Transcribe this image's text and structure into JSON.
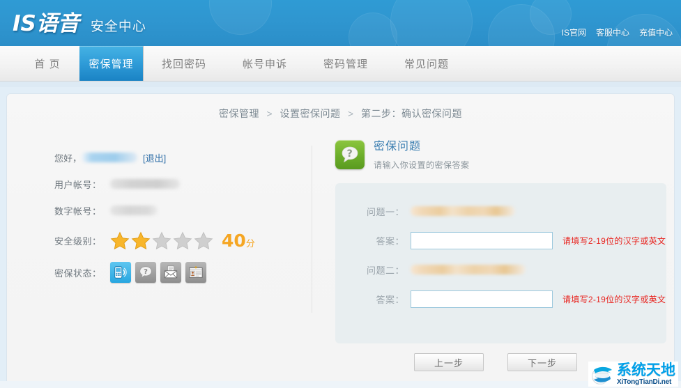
{
  "header": {
    "logo_main": "IS语音",
    "logo_sub": "安全中心",
    "links": [
      {
        "label": "IS官网",
        "name": "link-official-site"
      },
      {
        "label": "客服中心",
        "name": "link-service-center"
      },
      {
        "label": "充值中心",
        "name": "link-recharge-center"
      }
    ]
  },
  "nav": {
    "items": [
      {
        "label": "首 页",
        "active": false
      },
      {
        "label": "密保管理",
        "active": true
      },
      {
        "label": "找回密码",
        "active": false
      },
      {
        "label": "帐号申诉",
        "active": false
      },
      {
        "label": "密码管理",
        "active": false
      },
      {
        "label": "常见问题",
        "active": false
      }
    ]
  },
  "breadcrumb": {
    "item1": "密保管理",
    "sep1": ">",
    "item2": "设置密保问题",
    "sep2": ">",
    "item3": "第二步：确认密保问题"
  },
  "account": {
    "greeting_label": "您好，",
    "username_value": "",
    "logout_label": "[退出]",
    "user_account_label": "用户帐号：",
    "user_account_value": "",
    "number_account_label": "数字帐号：",
    "number_account_value": "",
    "security_level_label": "安全级别：",
    "security_score": "40",
    "security_score_unit": "分",
    "stars_total": 5,
    "stars_filled": 2,
    "security_status_label": "密保状态：",
    "status_icons": [
      {
        "name": "mobile-phone-icon",
        "active": true
      },
      {
        "name": "question-mark-icon",
        "active": false
      },
      {
        "name": "email-icon",
        "active": false
      },
      {
        "name": "id-card-icon",
        "active": false
      }
    ]
  },
  "question_panel": {
    "icon_name": "question-bubble-icon",
    "title": "密保问题",
    "subtitle": "请输入你设置的密保答案",
    "rows": [
      {
        "question_label": "问题一：",
        "question_value": "",
        "answer_label": "答案：",
        "answer_value": "",
        "answer_placeholder": "",
        "hint": "请填写2-19位的汉字或英文",
        "focused": true
      },
      {
        "question_label": "问题二：",
        "question_value": "",
        "answer_label": "答案：",
        "answer_value": "",
        "answer_placeholder": "",
        "hint": "请填写2-19位的汉字或英文",
        "focused": false
      }
    ],
    "prev_button": "上一步",
    "next_button": "下一步"
  },
  "watermark": {
    "cn": "系统天地",
    "en": "XiTongTianDi.net"
  },
  "colors": {
    "header_blue": "#2f96d0",
    "tab_active_blue": "#2f9cd8",
    "accent_orange": "#f5a623",
    "error_red": "#e8231e",
    "link_blue": "#2f6fa8",
    "title_blue": "#3c7fb1",
    "green_icon": "#6cae2a"
  }
}
